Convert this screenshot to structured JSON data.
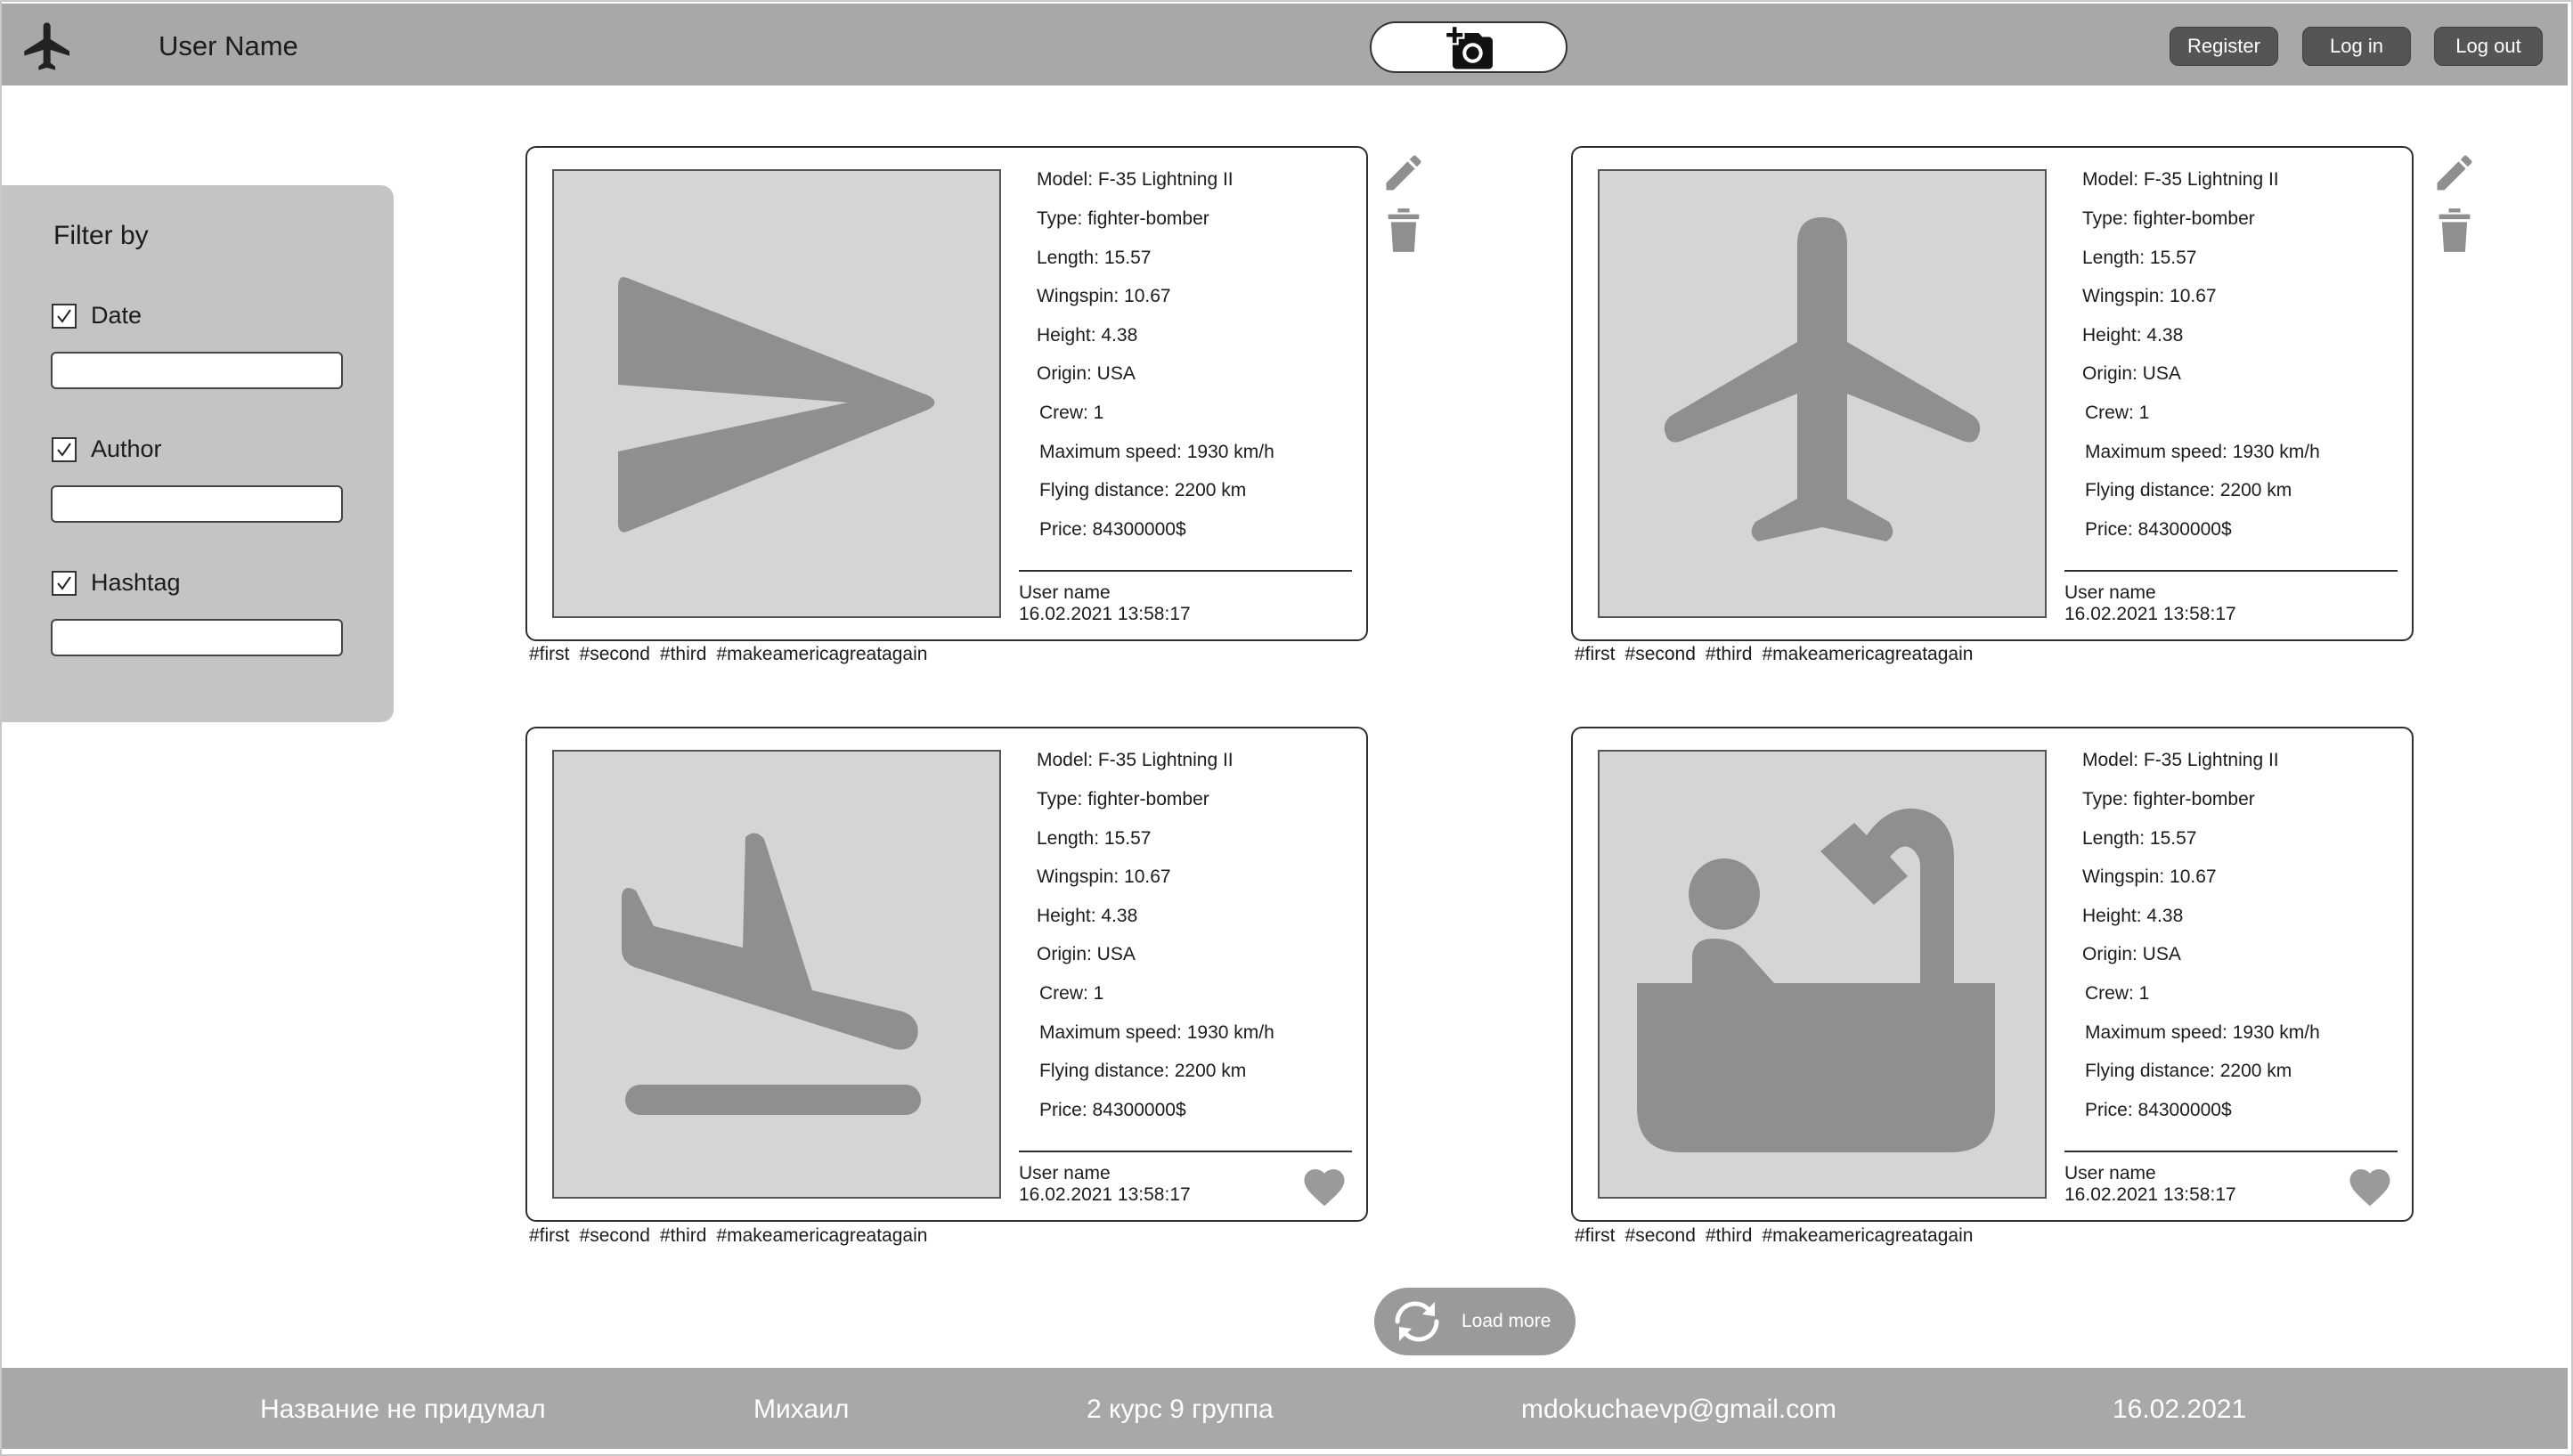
{
  "header": {
    "user_name": "User Name",
    "register_label": "Register",
    "login_label": "Log in",
    "logout_label": "Log out",
    "logo_icon": "airplane-icon",
    "add_photo_icon": "add-camera-icon"
  },
  "sidebar": {
    "title": "Filter by",
    "filters": [
      {
        "label": "Date",
        "checked": true,
        "value": ""
      },
      {
        "label": "Author",
        "checked": true,
        "value": ""
      },
      {
        "label": "Hashtag",
        "checked": true,
        "value": ""
      }
    ]
  },
  "posts": [
    {
      "image_icon": "plane-arrow-icon",
      "specs": [
        "Model:  F-35 Lightning II",
        "Type: fighter-bomber",
        "Length: 15.57",
        "Wingspin: 10.67",
        "Height: 4.38",
        "Origin: USA",
        "Crew: 1",
        "Maximum speed: 1930 km/h",
        "Flying distance: 2200 km",
        "Price: 84300000$"
      ],
      "user": "User name",
      "date": "16.02.2021 13:58:17",
      "hashtags": [
        "#first",
        "#second",
        "#third",
        "#makeamericagreatagain"
      ]
    },
    {
      "image_icon": "airplane-icon",
      "specs": [
        "Model:  F-35 Lightning II",
        "Type: fighter-bomber",
        "Length: 15.57",
        "Wingspin: 10.67",
        "Height: 4.38",
        "Origin: USA",
        "Crew: 1",
        "Maximum speed: 1930 km/h",
        "Flying distance: 2200 km",
        "Price: 84300000$"
      ],
      "user": "User name",
      "date": "16.02.2021 13:58:17",
      "hashtags": [
        "#first",
        "#second",
        "#third",
        "#makeamericagreatagain"
      ]
    },
    {
      "image_icon": "flight-land-icon",
      "specs": [
        "Model:  F-35 Lightning II",
        "Type: fighter-bomber",
        "Length: 15.57",
        "Wingspin: 10.67",
        "Height: 4.38",
        "Origin: USA",
        "Crew: 1",
        "Maximum speed: 1930 km/h",
        "Flying distance: 2200 km",
        "Price: 84300000$"
      ],
      "user": "User name",
      "date": "16.02.2021 13:58:17",
      "hashtags": [
        "#first",
        "#second",
        "#third",
        "#makeamericagreatagain"
      ]
    },
    {
      "image_icon": "bathtub-icon",
      "specs": [
        "Model:  F-35 Lightning II",
        "Type: fighter-bomber",
        "Length: 15.57",
        "Wingspin: 10.67",
        "Height: 4.38",
        "Origin: USA",
        "Crew: 1",
        "Maximum speed: 1930 km/h",
        "Flying distance: 2200 km",
        "Price: 84300000$"
      ],
      "user": "User name",
      "date": "16.02.2021 13:58:17",
      "hashtags": [
        "#first",
        "#second",
        "#third",
        "#makeamericagreatagain"
      ]
    }
  ],
  "load_more": {
    "label": "Load more",
    "icon": "refresh-icon"
  },
  "footer": {
    "project": "Название не придумал",
    "author": "Михаил",
    "group": "2 курс 9 группа",
    "email": "mdokuchaevp@gmail.com",
    "date": "16.02.2021"
  },
  "colors": {
    "header_bg": "#a8a8a8",
    "sidebar_bg": "#c4c4c4",
    "image_bg": "#d5d5d5",
    "icon_gray": "#8f8f8f",
    "button_dark": "#555555"
  }
}
